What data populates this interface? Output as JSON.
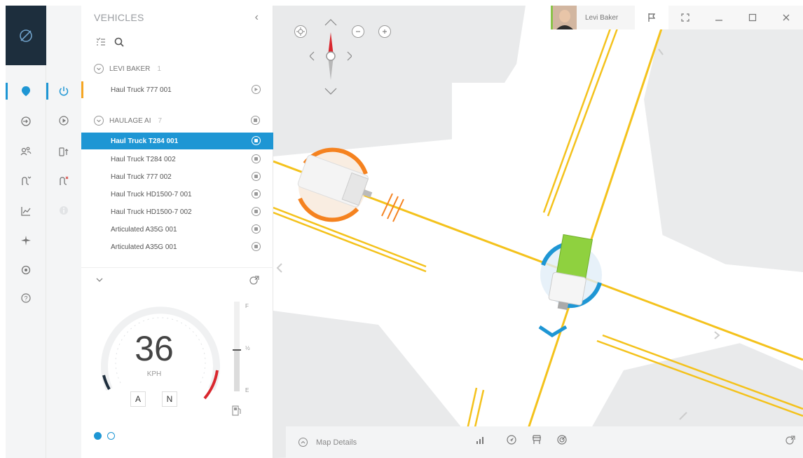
{
  "app": {
    "logo_icon": "compass-logo-icon",
    "accent": "#1e96d4",
    "warning": "#f5a623"
  },
  "rail": {
    "items": [
      {
        "icon": "map-marker-icon",
        "active": true
      },
      {
        "icon": "login-icon"
      },
      {
        "icon": "users-icon"
      },
      {
        "icon": "route-icon"
      },
      {
        "icon": "chart-icon"
      },
      {
        "icon": "plane-icon"
      },
      {
        "icon": "settings-icon"
      },
      {
        "icon": "help-icon"
      }
    ]
  },
  "rail2": {
    "items": [
      {
        "icon": "power-icon",
        "active": true
      },
      {
        "icon": "play-icon"
      },
      {
        "icon": "vehicle-upload-icon"
      },
      {
        "icon": "route-alert-icon"
      },
      {
        "icon": "info-icon",
        "disabled": true
      }
    ]
  },
  "panel": {
    "title": "VEHICLES",
    "groups": [
      {
        "name": "LEVI BAKER",
        "count": "1",
        "vehicles": [
          {
            "name": "Haul Truck 777 001",
            "state": "play"
          }
        ]
      },
      {
        "name": "HAULAGE AI",
        "count": "7",
        "vehicles": [
          {
            "name": "Haul Truck T284 001",
            "state": "pause",
            "selected": true
          },
          {
            "name": "Haul Truck T284 002",
            "state": "pause"
          },
          {
            "name": "Haul Truck 777 002",
            "state": "pause"
          },
          {
            "name": "Haul Truck HD1500-7 001",
            "state": "pause"
          },
          {
            "name": "Haul Truck HD1500-7 002",
            "state": "pause"
          },
          {
            "name": "Articulated A35G 001",
            "state": "pause"
          },
          {
            "name": "Articulated A35G 001",
            "state": "pause"
          }
        ]
      }
    ]
  },
  "speedometer": {
    "value": "36",
    "unit": "KPH",
    "modes": [
      "A",
      "N"
    ],
    "fuel_labels": {
      "full": "F",
      "half": "½",
      "empty": "E"
    },
    "fuel_level": 0.45
  },
  "pager": {
    "pages": 2,
    "current": 1
  },
  "header": {
    "user_name": "Levi Baker"
  },
  "bottom_bar": {
    "map_details_label": "Map Details",
    "icons": [
      "signal-icon",
      "navigation-icon",
      "vehicle-icon",
      "radar-icon",
      "share-icon"
    ]
  }
}
